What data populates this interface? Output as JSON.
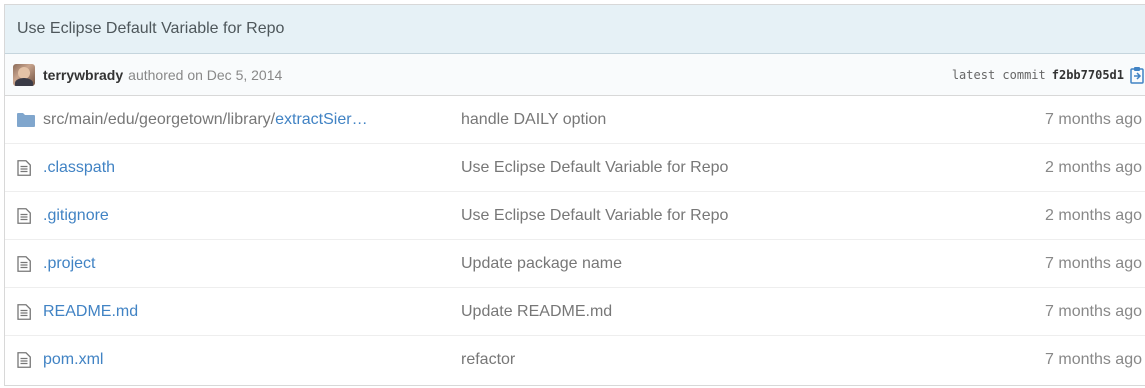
{
  "commit": {
    "title": "Use Eclipse Default Variable for Repo",
    "author": "terrywbrady",
    "authored_text": "authored on Dec 5, 2014",
    "latest_label": "latest commit",
    "sha": "f2bb7705d1"
  },
  "files": [
    {
      "type": "dir",
      "path_prefix": "src/main/edu/georgetown/library/",
      "name": "extractSier…",
      "message": "handle DAILY option",
      "age": "7 months ago"
    },
    {
      "type": "file",
      "path_prefix": "",
      "name": ".classpath",
      "message": "Use Eclipse Default Variable for Repo",
      "age": "2 months ago"
    },
    {
      "type": "file",
      "path_prefix": "",
      "name": ".gitignore",
      "message": "Use Eclipse Default Variable for Repo",
      "age": "2 months ago"
    },
    {
      "type": "file",
      "path_prefix": "",
      "name": ".project",
      "message": "Update package name",
      "age": "7 months ago"
    },
    {
      "type": "file",
      "path_prefix": "",
      "name": "README.md",
      "message": "Update README.md",
      "age": "7 months ago"
    },
    {
      "type": "file",
      "path_prefix": "",
      "name": "pom.xml",
      "message": "refactor",
      "age": "7 months ago"
    }
  ],
  "colors": {
    "link": "#4183c4",
    "header_bg": "#e6f1f6",
    "folder": "#80a6cd"
  },
  "icons": {
    "dir": "folder-icon",
    "file": "file-text-icon",
    "copy": "clipboard-copy-icon"
  }
}
